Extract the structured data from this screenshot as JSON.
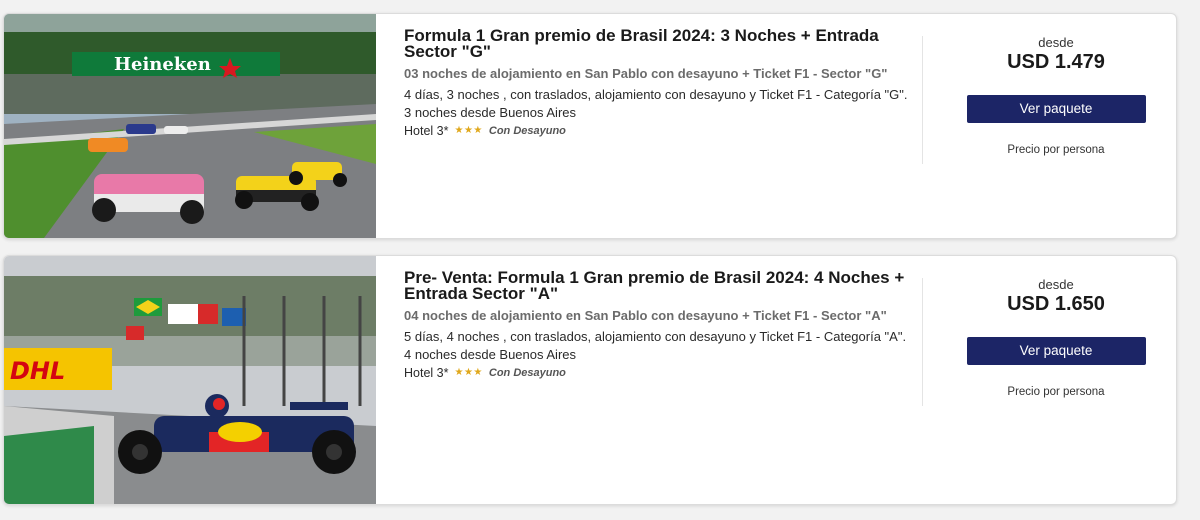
{
  "packages": [
    {
      "title": "Formula 1 Gran premio de Brasil 2024: 3 Noches + Entrada Sector \"G\"",
      "subtitle": "03 noches de alojamiento en San Pablo con desayuno + Ticket F1 - Sector \"G\"",
      "details": "4 días, 3 noches , con traslados, alojamiento con desayuno y Ticket F1 - Categoría \"G\".",
      "origin": "3 noches desde Buenos Aires",
      "hotel": "Hotel 3*",
      "stars": "★★★",
      "meal": "Con Desayuno",
      "price_prefix": "desde",
      "price": "USD 1.479",
      "button": "Ver paquete",
      "price_note": "Precio por persona",
      "banner_text": "Heineken"
    },
    {
      "title": "Pre- Venta: Formula 1 Gran premio de Brasil 2024: 4 Noches + Entrada Sector \"A\"",
      "subtitle": "04 noches de alojamiento en San Pablo con desayuno + Ticket F1 - Sector \"A\"",
      "details": "5 días, 4 noches , con traslados, alojamiento con desayuno y Ticket F1 - Categoría \"A\".",
      "origin": "4 noches desde Buenos Aires",
      "hotel": "Hotel 3*",
      "stars": "★★★",
      "meal": "Con Desayuno",
      "price_prefix": "desde",
      "price": "USD 1.650",
      "button": "Ver paquete",
      "price_note": "Precio por persona",
      "banner_text": "DHL"
    }
  ],
  "colors": {
    "button": "#1c2566",
    "stars": "#e0a81c"
  }
}
